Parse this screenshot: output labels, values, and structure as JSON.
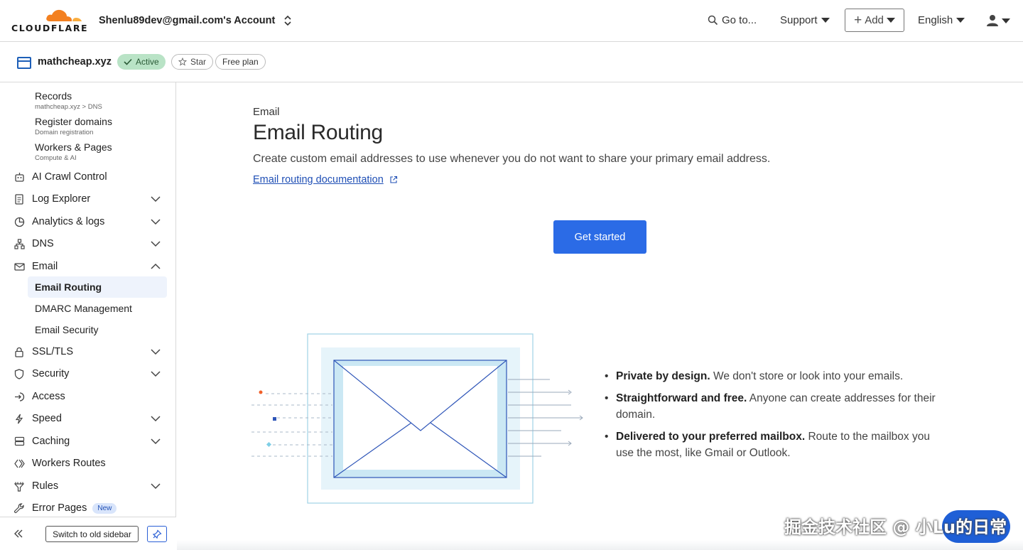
{
  "header": {
    "logo_text": "CLOUDFLARE",
    "account": "Shenlu89dev@gmail.com's Account",
    "goto": "Go to...",
    "support": "Support",
    "add": "Add",
    "language": "English"
  },
  "zone": {
    "name": "mathcheap.xyz",
    "status": "Active",
    "star": "Star",
    "plan": "Free plan"
  },
  "sidebar": {
    "recent": [
      {
        "title": "Records",
        "sub": "mathcheap.xyz > DNS"
      },
      {
        "title": "Register domains",
        "sub": "Domain registration"
      },
      {
        "title": "Workers & Pages",
        "sub": "Compute & AI"
      }
    ],
    "items": [
      {
        "label": "AI Crawl Control"
      },
      {
        "label": "Log Explorer"
      },
      {
        "label": "Analytics & logs"
      },
      {
        "label": "DNS"
      },
      {
        "label": "Email"
      },
      {
        "label": "SSL/TLS"
      },
      {
        "label": "Security"
      },
      {
        "label": "Access"
      },
      {
        "label": "Speed"
      },
      {
        "label": "Caching"
      },
      {
        "label": "Workers Routes"
      },
      {
        "label": "Rules"
      },
      {
        "label": "Error Pages",
        "badge": "New"
      }
    ],
    "email_sub": [
      {
        "label": "Email Routing"
      },
      {
        "label": "DMARC Management"
      },
      {
        "label": "Email Security"
      }
    ],
    "footer_button": "Switch to old sidebar"
  },
  "main": {
    "breadcrumb": "Email",
    "title": "Email Routing",
    "description": "Create custom email addresses to use whenever you do not want to share your primary email address.",
    "doc_link": "Email routing documentation",
    "cta": "Get started",
    "features": [
      {
        "bold": "Private by design.",
        "text": " We don't store or look into your emails."
      },
      {
        "bold": "Straightforward and free.",
        "text": " Anyone can create addresses for their domain."
      },
      {
        "bold": "Delivered to your preferred mailbox.",
        "text": " Route to the mailbox you use the most, like Gmail or Outlook."
      }
    ]
  },
  "watermark": "掘金技术社区 @ 小Lu的日常",
  "colors": {
    "primary": "#2b6be6",
    "link": "#1f4fb5",
    "active_pill": "#b9e3c6",
    "selected_bg": "#eef3fc",
    "cloud_orange": "#f38020"
  }
}
